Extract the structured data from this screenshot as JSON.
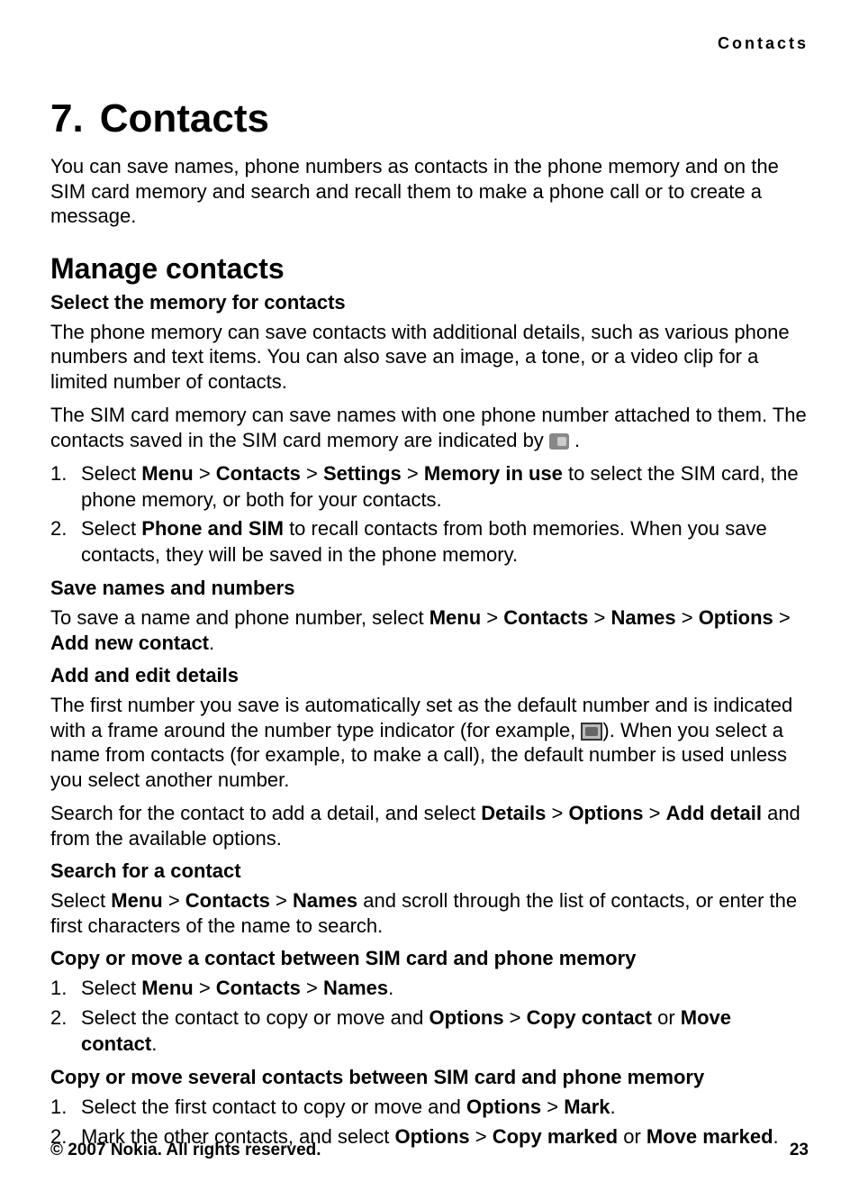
{
  "header": {
    "label": "Contacts"
  },
  "chapter": {
    "num": "7.",
    "title": "Contacts"
  },
  "intro": "You can save names, phone numbers as contacts in the phone memory and on the SIM card memory and search and recall them to make a phone call or to create a message.",
  "section": {
    "title": "Manage contacts"
  },
  "sub1": {
    "title": "Select the memory for contacts",
    "p1": "The phone memory can save contacts with additional details, such as various phone numbers and text items. You can also save an image, a tone, or a video clip for a limited number of contacts.",
    "p2a": "The SIM card memory can save names with one phone number attached to them. The contacts saved in the SIM card memory are indicated by ",
    "p2b": " .",
    "li1a": "Select ",
    "li1_menu": "Menu",
    "li1_gt1": " > ",
    "li1_contacts": "Contacts",
    "li1_gt2": " > ",
    "li1_settings": "Settings",
    "li1_gt3": " > ",
    "li1_memory": "Memory in use",
    "li1b": " to select the SIM card, the phone memory, or both for your contacts.",
    "li2a": "Select ",
    "li2_phone": "Phone and SIM",
    "li2b": " to recall contacts from both memories. When you save contacts, they will be saved in the phone memory."
  },
  "sub2": {
    "title": "Save names and numbers",
    "p1a": "To save a name and phone number, select ",
    "menu": "Menu",
    "gt1": " > ",
    "contacts": "Contacts",
    "gt2": " > ",
    "names": "Names",
    "gt3": " > ",
    "options": "Options",
    "gt4": " > ",
    "add": "Add new contact",
    "p1b": "."
  },
  "sub3": {
    "title": "Add and edit details",
    "p1a": "The first number you save is automatically set as the default number and is indicated with a frame around the number type indicator (for example, ",
    "p1b": "). When you select a name from contacts (for example, to make a call), the default number is used unless you select another number.",
    "p2a": "Search for the contact to add a detail, and select ",
    "details": "Details",
    "gt1": " > ",
    "options": "Options",
    "gt2": " > ",
    "adddetail": "Add detail",
    "p2b": " and from the available options."
  },
  "sub4": {
    "title": "Search for a contact",
    "p1a": "Select ",
    "menu": "Menu",
    "gt1": " > ",
    "contacts": "Contacts",
    "gt2": " > ",
    "names": "Names",
    "p1b": " and scroll through the list of contacts, or enter the first characters of the name to search."
  },
  "sub5": {
    "title": "Copy or move a contact between SIM card and phone memory",
    "li1a": "Select ",
    "li1_menu": "Menu",
    "li1_gt1": " > ",
    "li1_contacts": "Contacts",
    "li1_gt2": " > ",
    "li1_names": "Names",
    "li1b": ".",
    "li2a": "Select the contact to copy or move and ",
    "li2_options": "Options",
    "li2_gt1": " > ",
    "li2_copy": "Copy contact",
    "li2_or": " or ",
    "li2_move": "Move contact",
    "li2b": "."
  },
  "sub6": {
    "title": "Copy or move several contacts between SIM card and phone memory",
    "li1a": "Select the first contact to copy or move and ",
    "li1_options": "Options",
    "li1_gt1": " > ",
    "li1_mark": "Mark",
    "li1b": ".",
    "li2a": "Mark the other contacts, and select ",
    "li2_options": "Options",
    "li2_gt1": " > ",
    "li2_copy": "Copy marked",
    "li2_or": " or ",
    "li2_move": "Move marked",
    "li2b": "."
  },
  "footer": {
    "copyright": "© 2007 Nokia. All rights reserved.",
    "page": "23"
  }
}
